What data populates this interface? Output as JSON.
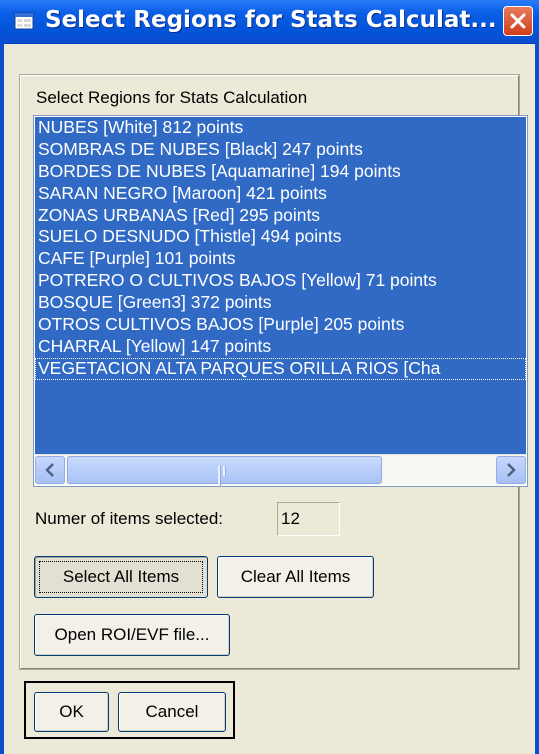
{
  "window": {
    "title": "Select Regions for Stats Calculat..."
  },
  "panel": {
    "label": "Select Regions for Stats Calculation"
  },
  "regions": [
    "NUBES [White] 812 points",
    "SOMBRAS DE NUBES [Black] 247 points",
    "BORDES DE NUBES [Aquamarine] 194 points",
    "SARAN NEGRO [Maroon] 421 points",
    "ZONAS URBANAS [Red] 295 points",
    "SUELO DESNUDO [Thistle] 494 points",
    "CAFE [Purple] 101 points",
    "POTRERO O CULTIVOS BAJOS [Yellow] 71 points",
    "BOSQUE [Green3] 372 points",
    "OTROS CULTIVOS BAJOS [Purple] 205 points",
    "CHARRAL [Yellow] 147 points",
    "VEGETACION ALTA PARQUES ORILLA RIOS [Cha"
  ],
  "selection": {
    "count_label": "Numer of items selected:",
    "count_value": "12"
  },
  "buttons": {
    "select_all": "Select All Items",
    "clear_all": "Clear All Items",
    "open_file": "Open ROI/EVF file...",
    "ok": "OK",
    "cancel": "Cancel"
  },
  "colors": {
    "title_bar": "#0254d8",
    "selection_highlight": "#316ac5",
    "close_button": "#d03f1e"
  },
  "icons": {
    "title": "app-window-icon",
    "close": "close-x-icon",
    "scroll_left": "arrow-left-icon",
    "scroll_right": "arrow-right-icon"
  }
}
